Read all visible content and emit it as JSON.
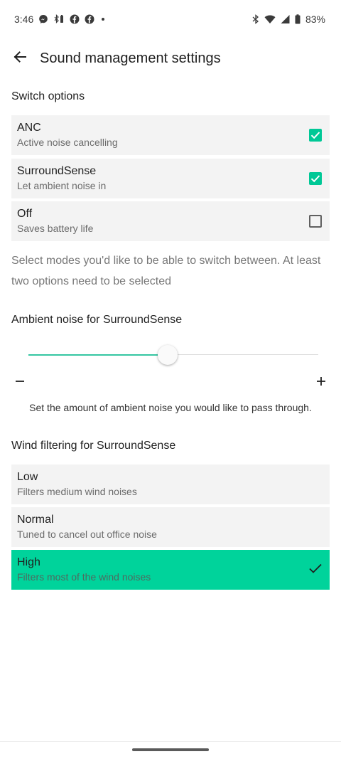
{
  "status_bar": {
    "time": "3:46",
    "battery": "83%",
    "icons_left": [
      "messenger-icon",
      "bluetooth-battery-icon",
      "facebook-icon",
      "facebook-icon",
      "notification-dot-icon"
    ],
    "icons_right": [
      "bluetooth-icon",
      "wifi-icon",
      "signal-icon",
      "battery-icon"
    ]
  },
  "header": {
    "title": "Sound management settings",
    "back_icon": "arrow-left-icon"
  },
  "switch_options": {
    "title": "Switch options",
    "items": [
      {
        "label": "ANC",
        "sublabel": "Active noise cancelling",
        "checked": true
      },
      {
        "label": "SurroundSense",
        "sublabel": "Let ambient noise in",
        "checked": true
      },
      {
        "label": "Off",
        "sublabel": "Saves battery life",
        "checked": false
      }
    ],
    "helper": "Select modes you'd like to be able to switch between. At least two options need to be selected"
  },
  "ambient": {
    "title": "Ambient noise for SurroundSense",
    "level_fraction": 0.48,
    "minus_icon": "minus-icon",
    "plus_icon": "plus-icon",
    "caption": "Set the amount of ambient noise you would like to pass through."
  },
  "wind": {
    "title": "Wind filtering for SurroundSense",
    "items": [
      {
        "label": "Low",
        "sublabel": "Filters medium wind noises",
        "selected": false
      },
      {
        "label": "Normal",
        "sublabel": "Tuned to cancel out office noise",
        "selected": false
      },
      {
        "label": "High",
        "sublabel": "Filters most of the wind noises",
        "selected": true
      }
    ]
  },
  "colors": {
    "accent": "#00d39b",
    "checkbox": "#00c896",
    "card_bg": "#f3f3f3"
  }
}
